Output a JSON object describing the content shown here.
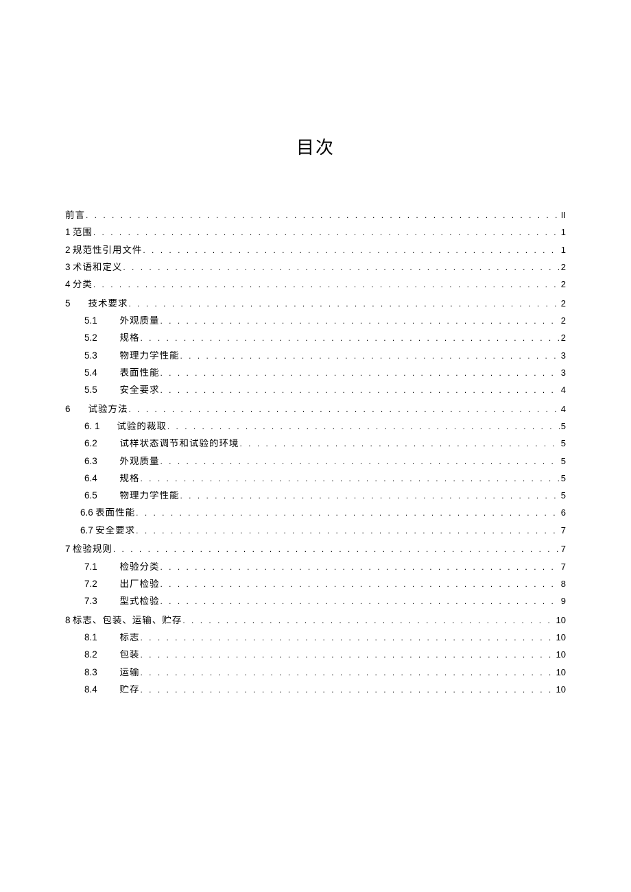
{
  "title": "目次",
  "entries": [
    {
      "indent": "indent-0",
      "num": "",
      "text": "前言",
      "page": "II",
      "gap": false,
      "style": "plain"
    },
    {
      "indent": "indent-0",
      "num": "1",
      "text": "范围",
      "page": "1",
      "gap": false,
      "style": "tight"
    },
    {
      "indent": "indent-0",
      "num": "2",
      "text": "规范性引用文件",
      "page": "1",
      "gap": false,
      "style": "tight"
    },
    {
      "indent": "indent-0",
      "num": "3",
      "text": "术语和定义",
      "page": "2",
      "gap": false,
      "style": "tight"
    },
    {
      "indent": "indent-0",
      "num": "4",
      "text": "分类",
      "page": "2",
      "gap": false,
      "style": "tight"
    },
    {
      "indent": "indent-0",
      "num": "5",
      "text": "技术要求",
      "page": "2",
      "gap": true,
      "style": "spaced"
    },
    {
      "indent": "indent-1",
      "num": "5.1",
      "text": "外观质量",
      "page": "2",
      "gap": false,
      "style": "sub"
    },
    {
      "indent": "indent-1",
      "num": "5.2",
      "text": "规格",
      "page": "2",
      "gap": false,
      "style": "sub"
    },
    {
      "indent": "indent-1",
      "num": "5.3",
      "text": "物理力学性能",
      "page": "3",
      "gap": false,
      "style": "sub"
    },
    {
      "indent": "indent-1",
      "num": "5.4",
      "text": "表面性能",
      "page": "3",
      "gap": false,
      "style": "sub"
    },
    {
      "indent": "indent-1",
      "num": "5.5",
      "text": "安全要求",
      "page": "4",
      "gap": false,
      "style": "sub"
    },
    {
      "indent": "indent-0",
      "num": "6",
      "text": "试验方法",
      "page": "4",
      "gap": true,
      "style": "spaced"
    },
    {
      "indent": "indent-1",
      "num": "6.  1",
      "text": "试验的裁取",
      "page": "5",
      "gap": false,
      "style": "sub-loose"
    },
    {
      "indent": "indent-1",
      "num": "6.2",
      "text": "试样状态调节和试验的环境",
      "page": "5",
      "gap": false,
      "style": "sub"
    },
    {
      "indent": "indent-1",
      "num": "6.3",
      "text": "外观质量",
      "page": "5",
      "gap": false,
      "style": "sub"
    },
    {
      "indent": "indent-1",
      "num": "6.4",
      "text": "规格",
      "page": "5",
      "gap": false,
      "style": "sub"
    },
    {
      "indent": "indent-1",
      "num": "6.5",
      "text": "物理力学性能",
      "page": "5",
      "gap": false,
      "style": "sub"
    },
    {
      "indent": "indent-1b",
      "num": "6.6",
      "text": "表面性能",
      "page": "6",
      "gap": false,
      "style": "sub-tight"
    },
    {
      "indent": "indent-1b",
      "num": "6.7",
      "text": "安全要求",
      "page": "7",
      "gap": false,
      "style": "sub-tight"
    },
    {
      "indent": "indent-0",
      "num": "7",
      "text": "检验规则",
      "page": "7",
      "gap": true,
      "style": "tight"
    },
    {
      "indent": "indent-1",
      "num": "7.1",
      "text": "检验分类",
      "page": "7",
      "gap": false,
      "style": "sub"
    },
    {
      "indent": "indent-1",
      "num": "7.2",
      "text": "出厂检验",
      "page": "8",
      "gap": false,
      "style": "sub"
    },
    {
      "indent": "indent-1",
      "num": "7.3",
      "text": "型式检验",
      "page": "9",
      "gap": false,
      "style": "sub"
    },
    {
      "indent": "indent-0",
      "num": "8",
      "text": "标志、包装、运输、贮存",
      "page": "10",
      "gap": true,
      "style": "tight"
    },
    {
      "indent": "indent-1",
      "num": "8.1",
      "text": "标志",
      "page": "10",
      "gap": false,
      "style": "sub"
    },
    {
      "indent": "indent-1",
      "num": "8.2",
      "text": "包装",
      "page": "10",
      "gap": false,
      "style": "sub"
    },
    {
      "indent": "indent-1",
      "num": "8.3",
      "text": "运输",
      "page": "10",
      "gap": false,
      "style": "sub"
    },
    {
      "indent": "indent-1",
      "num": "8.4",
      "text": "贮存",
      "page": "10",
      "gap": false,
      "style": "sub"
    }
  ]
}
